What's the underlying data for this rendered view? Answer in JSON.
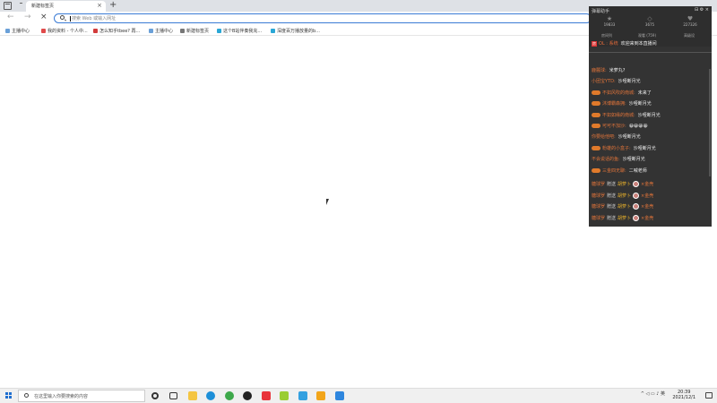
{
  "browser": {
    "tab_title": "新建标签页",
    "tab_close": "×",
    "new_tab": "+",
    "address_placeholder": "搜索 Web 或输入网址",
    "bookmarks": [
      "主播中心",
      "我的资料 - 个人中...",
      "怎么知乎tbee? 再...",
      "主播中心",
      "新建标签页",
      "这个B站伴奏我充...",
      "深度百万播放量的b..."
    ]
  },
  "widget": {
    "title": "弹幕助手",
    "controls": "⊟ ⚙ ×",
    "stats": [
      {
        "icon": "★",
        "value": "19833"
      },
      {
        "icon": "◇",
        "value": "3675"
      },
      {
        "icon": "♥",
        "value": "227326"
      }
    ],
    "tabs": [
      "房间列",
      "观看 (759)",
      "高级设"
    ],
    "notice": {
      "badge": "房",
      "user": "OL : 系统",
      "text": "欢迎来到本直播间"
    },
    "messages": [
      {
        "name": "鹿麓球:",
        "text": "米萝丸?",
        "level": false
      },
      {
        "name": "小团宝YTD:",
        "text": "沙哑断月光",
        "level": false
      },
      {
        "name": "不如风吹的南城:",
        "text": "未来了",
        "level": true
      },
      {
        "name": "沐博霸森拥:",
        "text": "沙哑断月光",
        "level": true
      },
      {
        "name": "不如如缘的南城:",
        "text": "沙哑断月光",
        "level": true
      },
      {
        "name": "可可不加沙:",
        "text": "😀😀😀😀",
        "level": true
      },
      {
        "name": "你要给他吧:",
        "text": "沙哑断月光",
        "level": false
      },
      {
        "name": "粉雄的小盒子:",
        "text": "沙哑断月光",
        "level": true
      },
      {
        "name": "不会说话的鱼:",
        "text": "沙哑断月光",
        "level": false
      },
      {
        "name": "三金四无聊:",
        "text": "二喊老师",
        "level": true
      }
    ],
    "gifts": [
      {
        "name": "糖球罗",
        "verb": "赠送",
        "item": "胡萝卜",
        "count": "×金壳"
      },
      {
        "name": "糖球罗",
        "verb": "赠送",
        "item": "胡萝卜",
        "count": "×金壳"
      },
      {
        "name": "糖球罗",
        "verb": "赠送",
        "item": "胡萝卜",
        "count": "×金壳"
      },
      {
        "name": "糖球罗",
        "verb": "赠送",
        "item": "胡萝卜",
        "count": "×金壳"
      }
    ]
  },
  "taskbar": {
    "search_placeholder": "在这里输入你要搜索的内容",
    "time": "20:39",
    "date": "2021/12/1",
    "tray": "^ ◁ ▭ ♪ 英"
  },
  "colors": {
    "widget_bg": "#333333",
    "username": "#e0743a",
    "accent": "#3a7bd5"
  }
}
